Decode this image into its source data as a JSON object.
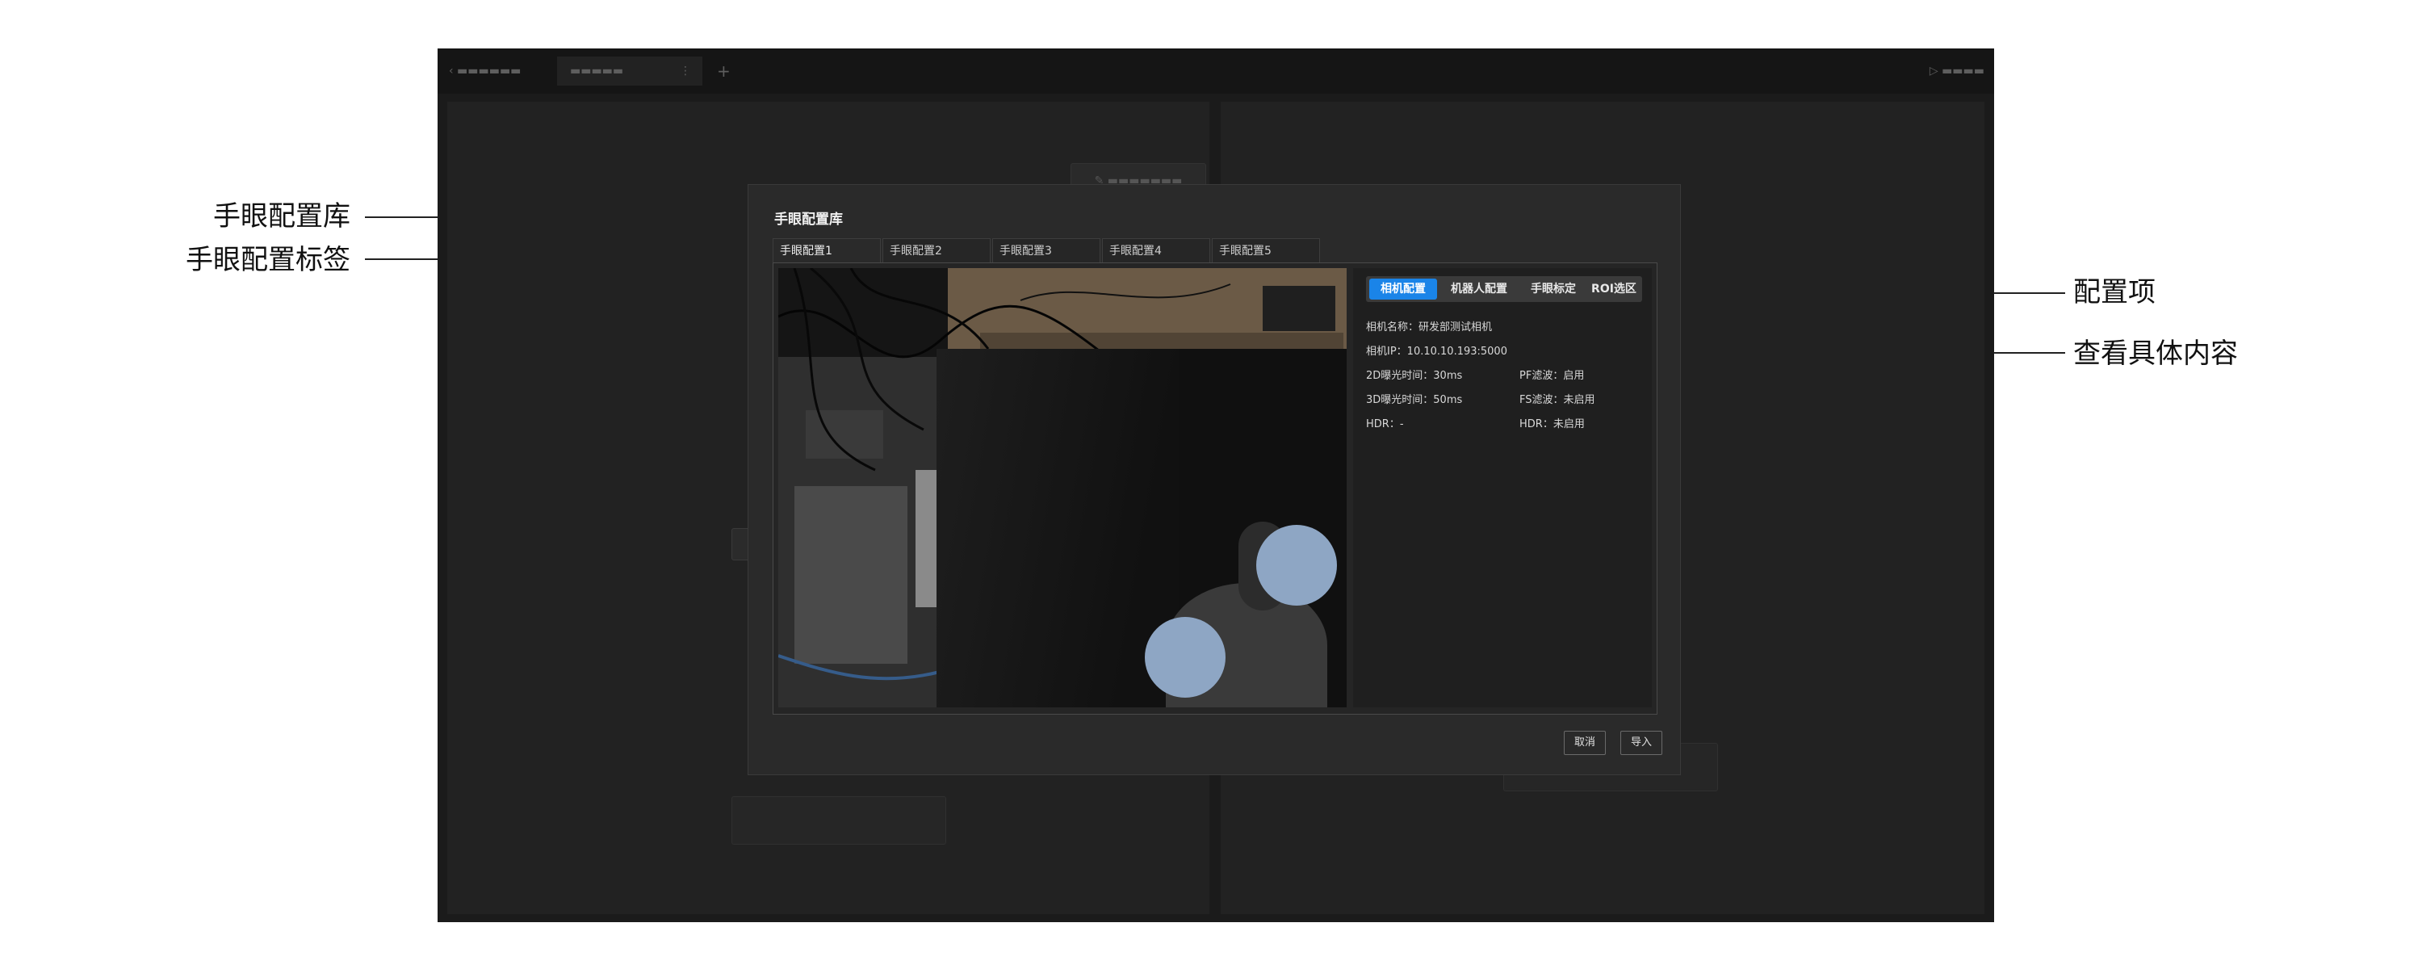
{
  "annotations": {
    "library": "手眼配置库",
    "tab_label": "手眼配置标签",
    "config_item": "配置项",
    "content": "查看具体内容"
  },
  "modal": {
    "title": "手眼配置库",
    "tabs": [
      "手眼配置1",
      "手眼配置2",
      "手眼配置3",
      "手眼配置4",
      "手眼配置5"
    ],
    "segments": [
      "相机配置",
      "机器人配置",
      "手眼标定",
      "ROI选区"
    ],
    "details": {
      "camera_name": "相机名称：研发部测试相机",
      "camera_ip": "相机IP：10.10.10.193:5000",
      "exposure_2d": "2D曝光时间：30ms",
      "pf_filter": "PF滤波：启用",
      "exposure_3d": "3D曝光时间：50ms",
      "fs_filter": "FS滤波：未启用",
      "hdr_left": "HDR：-",
      "hdr_right": "HDR：未启用"
    },
    "cancel": "取消",
    "import": "导入"
  },
  "colors": {
    "accent": "#1a84e8",
    "app_bg": "#1b1b1b",
    "modal_bg": "#2a2a2a"
  },
  "icons": [
    "plus-icon",
    "close-icon",
    "play-icon",
    "edit-icon"
  ]
}
